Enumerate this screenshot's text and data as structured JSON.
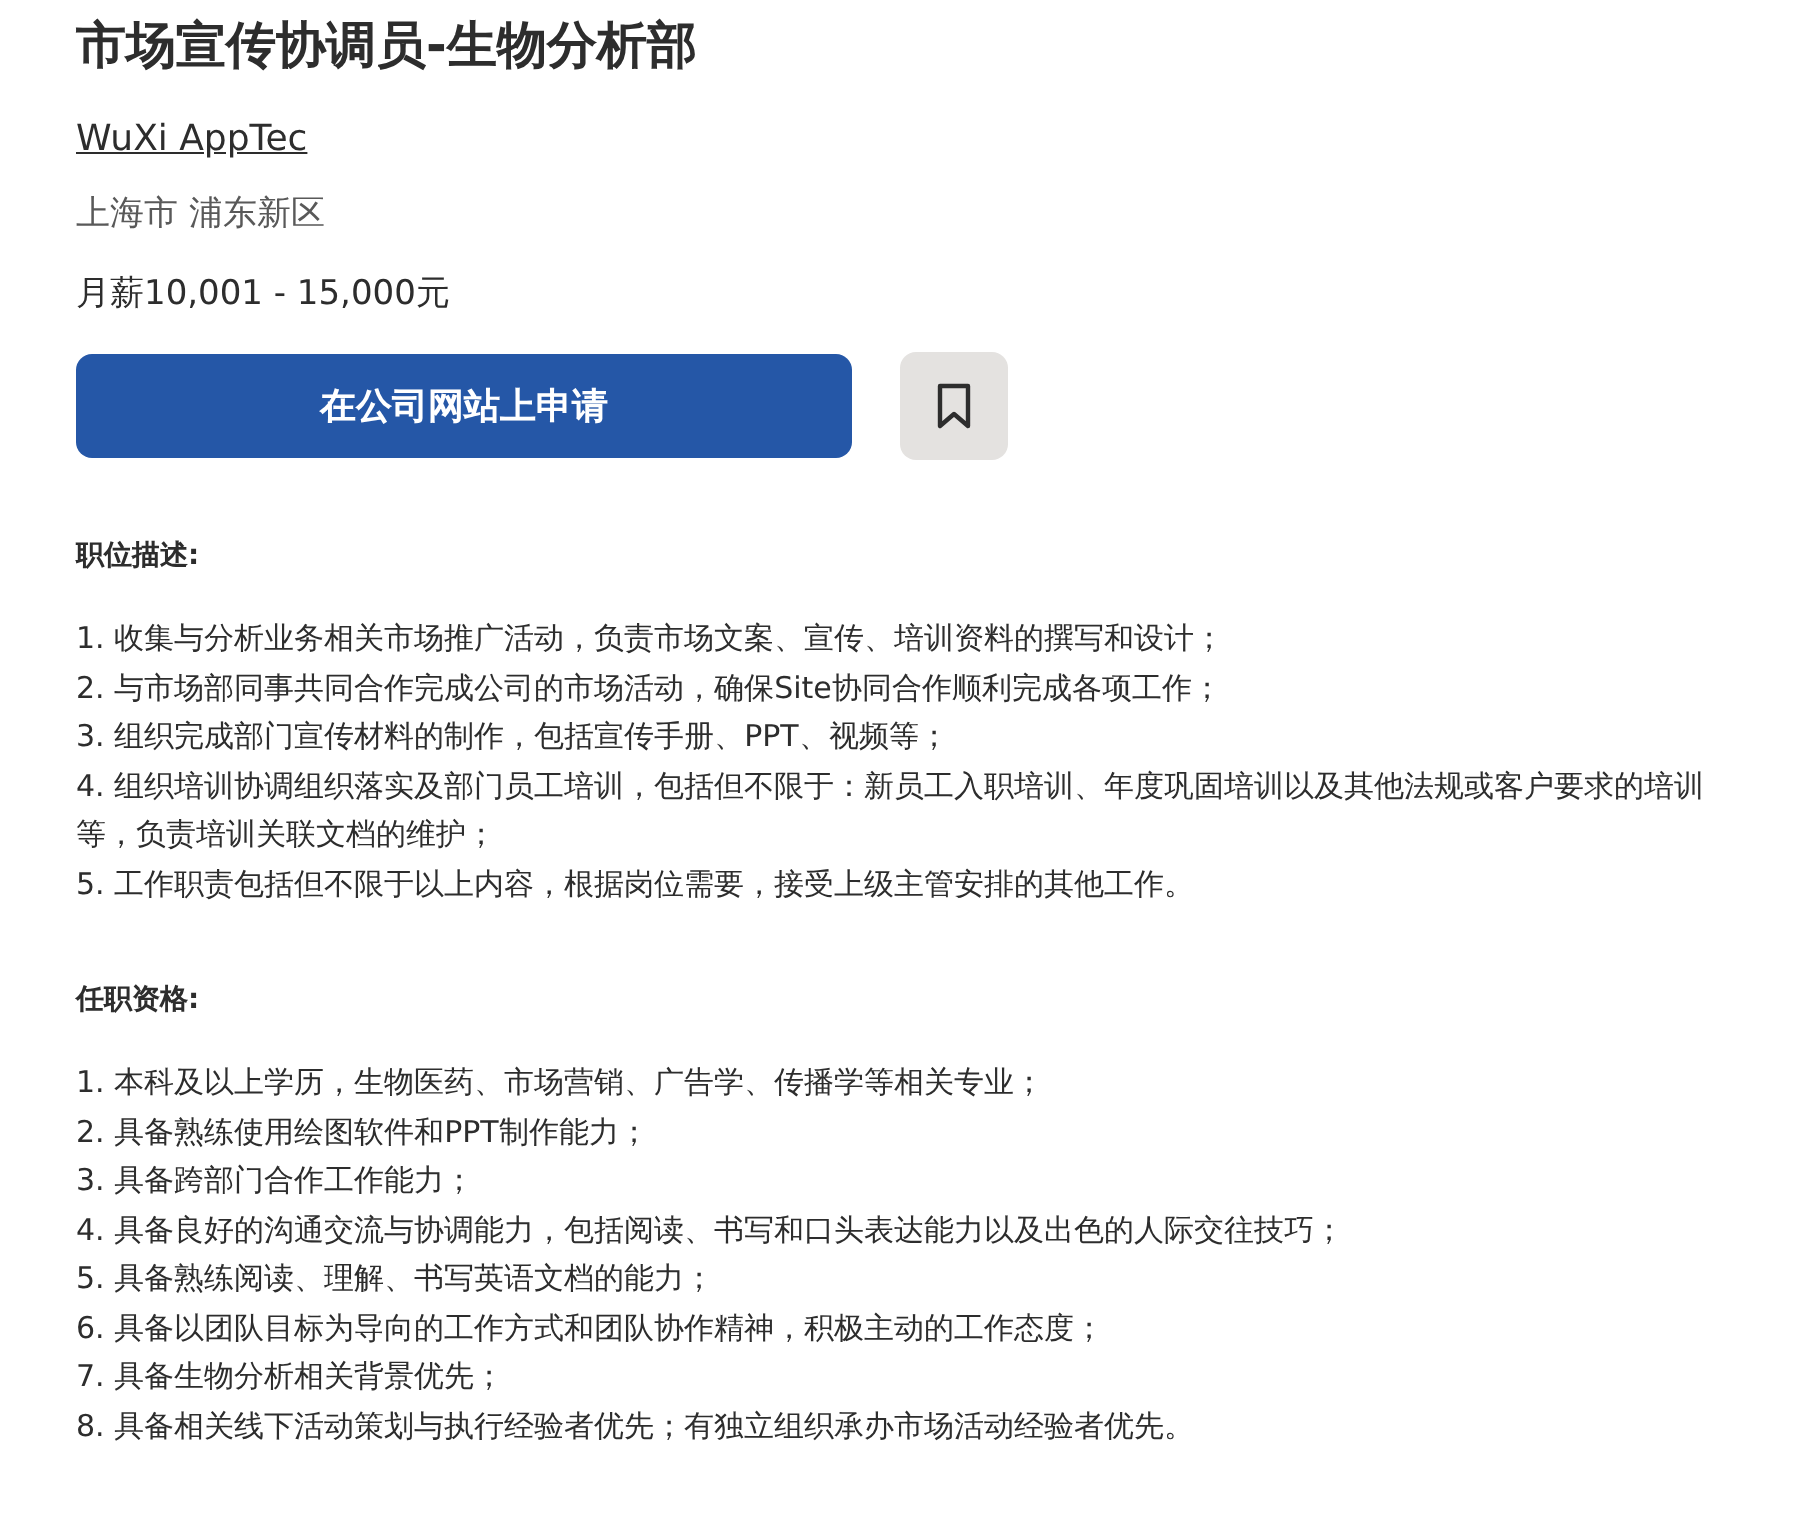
{
  "job_title": "市场宣传协调员-生物分析部",
  "company": "WuXi AppTec",
  "location": "上海市 浦东新区",
  "salary": "月薪10,001 - 15,000元",
  "apply_button": "在公司网站上申请",
  "sections": [
    {
      "heading": "职位描述:",
      "items": [
        "1. 收集与分析业务相关市场推广活动，负责市场文案、宣传、培训资料的撰写和设计；",
        "2. 与市场部同事共同合作完成公司的市场活动，确保Site协同合作顺利完成各项工作；",
        "3. 组织完成部门宣传材料的制作，包括宣传手册、PPT、视频等；",
        "4. 组织培训协调组织落实及部门员工培训，包括但不限于：新员工入职培训、年度巩固培训以及其他法规或客户要求的培训等，负责培训关联文档的维护；",
        "5. 工作职责包括但不限于以上内容，根据岗位需要，接受上级主管安排的其他工作。"
      ]
    },
    {
      "heading": "任职资格:",
      "items": [
        "1. 本科及以上学历，生物医药、市场营销、广告学、传播学等相关专业；",
        "2. 具备熟练使用绘图软件和PPT制作能力；",
        "3. 具备跨部门合作工作能力；",
        "4. 具备良好的沟通交流与协调能力，包括阅读、书写和口头表达能力以及出色的人际交往技巧；",
        "5. 具备熟练阅读、理解、书写英语文档的能力；",
        "6. 具备以团队目标为导向的工作方式和团队协作精神，积极主动的工作态度；",
        "7. 具备生物分析相关背景优先；",
        "8. 具备相关线下活动策划与执行经验者优先；有独立组织承办市场活动经验者优先。"
      ]
    }
  ]
}
